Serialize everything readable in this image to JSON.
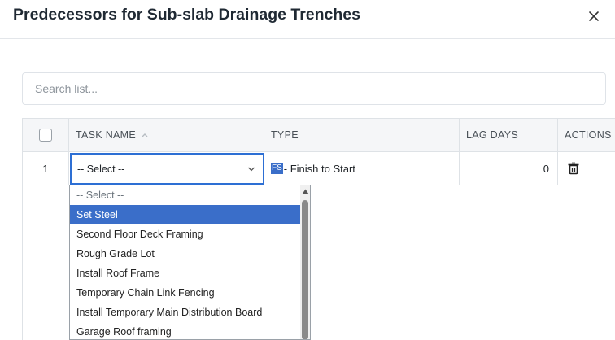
{
  "modal": {
    "title": "Predecessors for Sub-slab Drainage Trenches",
    "close_icon": "close-icon"
  },
  "search": {
    "placeholder": "Search list..."
  },
  "table": {
    "columns": {
      "task_name": "TASK NAME",
      "type": "TYPE",
      "lag_days": "LAG DAYS",
      "actions": "ACTIONS"
    },
    "sort_icon": "sort-up-icon",
    "rows": [
      {
        "number": "1",
        "task_select": "-- Select --",
        "type_badge": "FS",
        "type_label": "- Finish to Start",
        "lag_days": "0",
        "delete_icon": "trash-icon"
      }
    ]
  },
  "dropdown": {
    "options": [
      "-- Select --",
      "Set Steel",
      "Second Floor Deck Framing",
      "Rough Grade Lot",
      "Install Roof Frame",
      "Temporary Chain Link Fencing",
      "Install Temporary Main Distribution Board",
      "Garage Roof framing"
    ],
    "selected_option": "Set Steel"
  },
  "colors": {
    "accent": "#2d6fd4",
    "selected_bg": "#3a6ec9",
    "header_bg": "#f5f6f8",
    "border": "#dee2e6"
  }
}
